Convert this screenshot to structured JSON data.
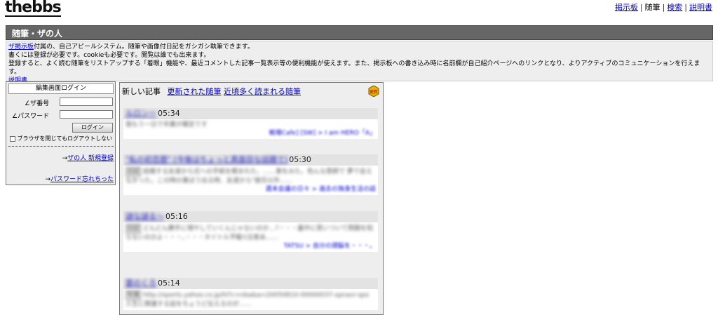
{
  "header": {
    "logo": "thebbs",
    "nav": [
      "掲示板",
      "随筆",
      "検索",
      "説明書"
    ]
  },
  "title": "随筆・ザの人",
  "intro": {
    "line1_link": "ザ掲示板",
    "line1_rest": "付属の、自己アピールシステム。随筆や画像付日記をガシガシ執筆できます。",
    "line2": "書くには登録が必要です。cookieも必要です。閲覧は誰でも出来ます。",
    "line3": "登録すると、よく読む随筆をリストアップする「着眼」機能や、最近コメントした記事一覧表示等の便利機能が使えます。また、掲示板への書き込み時に名前欄が自己紹介ページへのリンクとなり、よりアクティブのコミュニケーションを行えます。",
    "line4_link": "説明書"
  },
  "login": {
    "heading": "編集画面ログイン",
    "id_label": "ザ番号",
    "password_label": "パスワード",
    "button": "ログイン",
    "stay_logged_in": "ブラウザを閉じてもログアウトしない",
    "register_link": "ザの人 新規登録",
    "forgot_link": "パスワード忘れちった",
    "arrow": "→"
  },
  "feed": {
    "tab_current": "新しい記事",
    "tab_updated": "更新された随筆",
    "tab_popular": "近頃多く読まれる随筆",
    "badge": "更新",
    "entries": [
      {
        "title": "ルロンー",
        "time": "05:34",
        "body": "我もう一日で卒業が確定です",
        "footer_author": "戦場Cafe] [SW]",
        "footer_sep": ">",
        "footer_series": "I am HERO「A」"
      },
      {
        "title": "\"私の初恋歴\" [今後はちょっと真面目な話題で]",
        "time": "05:30",
        "tag": "日記",
        "body": "結婚する友達から式への手紙を頼まれた。……事をみた。色んな恩師で 夢で会えなかった。この時の重ぼう出る時、友達から\"彼氏以外……",
        "footer_author": "週末会議の日々",
        "footer_sep": ">",
        "footer_series": "過去の独身生活の話"
      },
      {
        "title": "謎な謎る〜",
        "time": "05:16",
        "tag": "日記",
        "body": "どんどん勝手に増やしていくんじゃないのか…?・・・最中に思いついて問題を知らないのかよ・・・。・・・タイトル予報!(注意あ……",
        "footer_author": "TATSU",
        "footer_sep": ">",
        "footer_series": "自分の頭脳を・・・。"
      },
      {
        "title": "雲のくろ",
        "time": "05:14",
        "tag": "写真",
        "body": "http://sports.yahoo.co.jp/hl?c=nba&a=20050810-00000037-spnavi-spo 人生に関連する話をちょうど伝えるのが……",
        "footer_author": "",
        "footer_sep": "",
        "footer_series": ""
      }
    ]
  }
}
